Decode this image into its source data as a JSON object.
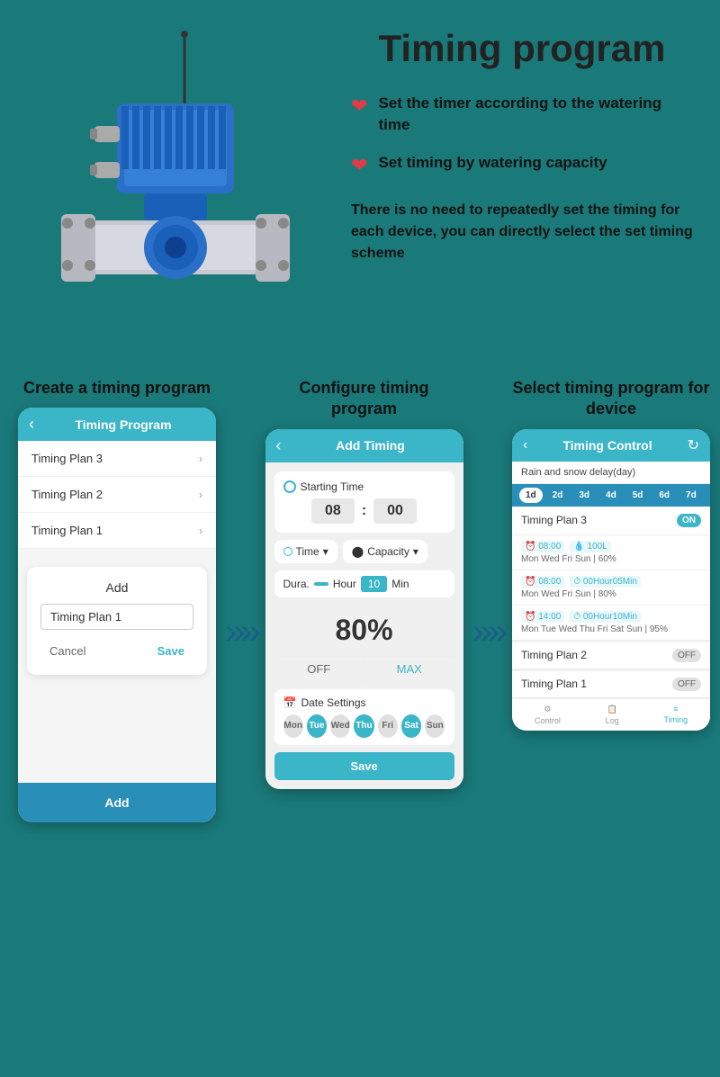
{
  "page": {
    "title": "Timing program",
    "background_color": "#1a7a7a"
  },
  "features": [
    {
      "id": "feature1",
      "text": "Set the timer according to the watering time"
    },
    {
      "id": "feature2",
      "text": "Set timing by watering capacity"
    }
  ],
  "description": "There is no need to repeatedly set the timing for each device, you can directly select the set timing scheme",
  "steps": [
    {
      "id": "step1",
      "title": "Create a timing program"
    },
    {
      "id": "step2",
      "title": "Configure timing program"
    },
    {
      "id": "step3",
      "title": "Select timing program for device"
    }
  ],
  "phone1": {
    "header_title": "Timing Program",
    "plans": [
      "Timing Plan 3",
      "Timing Plan 2",
      "Timing Plan 1"
    ],
    "dialog_add_label": "Add",
    "dialog_input_value": "Timing Plan 1",
    "dialog_cancel": "Cancel",
    "dialog_save": "Save",
    "bottom_add": "Add"
  },
  "phone2": {
    "header_title": "Add Timing",
    "starting_time_label": "Starting Time",
    "hour_value": "08",
    "minute_value": "00",
    "time_label": "Time",
    "capacity_label": "Capacity",
    "dura_label": "Dura.",
    "hour_unit": "Hour",
    "ten_value": "10",
    "min_unit": "Min",
    "percent": "80%",
    "off_label": "OFF",
    "max_label": "MAX",
    "date_settings_label": "Date Settings",
    "days": [
      {
        "label": "Mon",
        "active": false
      },
      {
        "label": "Tue",
        "active": true
      },
      {
        "label": "Wed",
        "active": false
      },
      {
        "label": "Thu",
        "active": true
      },
      {
        "label": "Fri",
        "active": false
      },
      {
        "label": "Sat",
        "active": true
      },
      {
        "label": "Sun",
        "active": false
      }
    ],
    "save_label": "Save"
  },
  "phone3": {
    "header_title": "Timing Control",
    "refresh_icon": "↻",
    "rain_delay_label": "Rain and snow delay(day)",
    "day_pills": [
      "1d",
      "2d",
      "3d",
      "4d",
      "5d",
      "6d",
      "7d"
    ],
    "active_pill": "1d",
    "plan3_title": "Timing Plan 3",
    "plan3_toggle": "ON",
    "schedules": [
      {
        "time": "08:00",
        "volume": "100L",
        "days": "Mon Wed Fri Sun | 60%"
      },
      {
        "time": "08:00",
        "duration": "00Hour05Min",
        "days": "Mon Wed Fri Sun | 80%"
      },
      {
        "time": "14:00",
        "duration": "00Hour10Min",
        "days": "Mon Tue Wed Thu Fri Sat Sun | 95%"
      }
    ],
    "plan2_title": "Timing Plan 2",
    "plan2_toggle": "OFF",
    "plan1_title": "Timing Plan 1",
    "plan1_toggle": "OFF",
    "nav_items": [
      {
        "label": "Control",
        "icon": "⚙",
        "active": false
      },
      {
        "label": "Log",
        "icon": "📋",
        "active": false
      },
      {
        "label": "Timing",
        "icon": "≡",
        "active": true
      }
    ]
  }
}
